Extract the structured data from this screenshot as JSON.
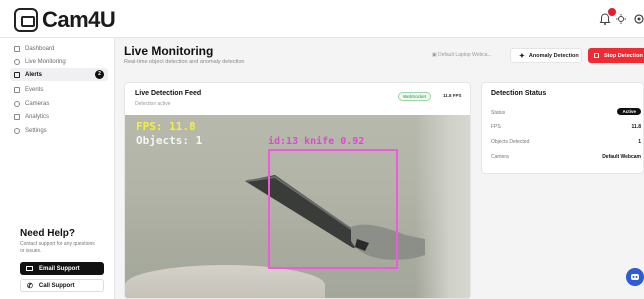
{
  "app": {
    "name": "Cam4U"
  },
  "sidebar": {
    "items": [
      {
        "label": "Dashboard",
        "active": false
      },
      {
        "label": "Live Monitoring",
        "active": false
      },
      {
        "label": "Alerts",
        "active": true,
        "badge": "2"
      },
      {
        "label": "Events",
        "active": false
      },
      {
        "label": "Cameras",
        "active": false
      },
      {
        "label": "Analytics",
        "active": false
      },
      {
        "label": "Settings",
        "active": false
      }
    ],
    "help": {
      "title": "Need Help?",
      "text": "Contact support for any questions or issues.",
      "email_label": "Email Support",
      "call_label": "Call Support"
    }
  },
  "topbar": {
    "notification_count": "1"
  },
  "header": {
    "title": "Live Monitoring",
    "subtitle": "Real-time object detection and anomaly detection",
    "camera_select": "Default Laptop Webca...",
    "anomaly_label": "Anomaly Detection",
    "stop_label": "Stop Detection"
  },
  "feed": {
    "title": "Live Detection Feed",
    "subtitle": "Detection active",
    "connection_badge": "WebSocket",
    "fps_label": "11.8 FPS",
    "overlay_fps": "FPS: 11.8",
    "overlay_objects": "Objects: 1",
    "detection_label": "id:13 knife 0.92"
  },
  "status": {
    "title": "Detection Status",
    "rows": [
      {
        "label": "Status",
        "value": "Active"
      },
      {
        "label": "FPS",
        "value": "11.8"
      },
      {
        "label": "Objects Detected",
        "value": "1"
      },
      {
        "label": "Camera",
        "value": "Default Webcam"
      }
    ]
  },
  "colors": {
    "accent_red": "#ef2b33",
    "detection_box": "#ea5cd9",
    "overlay_fps": "#f4f040"
  }
}
